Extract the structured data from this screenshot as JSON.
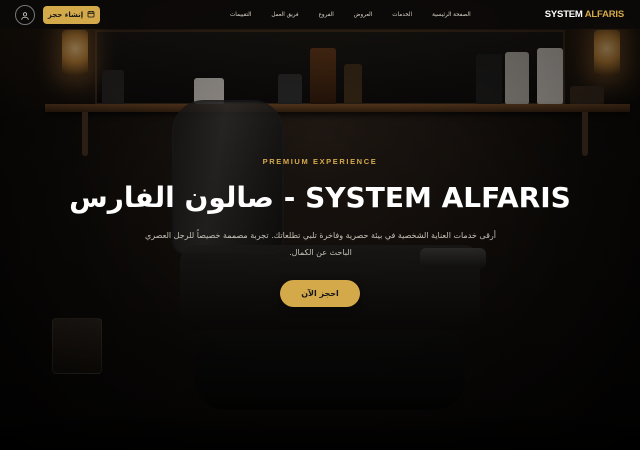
{
  "navbar": {
    "brand_primary": "SYSTEM",
    "brand_accent": "ALFARIS",
    "links": [
      {
        "label": "الصفحة الرئيسية"
      },
      {
        "label": "الخدمات"
      },
      {
        "label": "العروض"
      },
      {
        "label": "الفروع"
      },
      {
        "label": "فريق العمل"
      },
      {
        "label": "التقييمات"
      }
    ],
    "book_button_label": "إنشاء حجز",
    "book_button_icon": "calendar-icon",
    "user_icon": "user-icon"
  },
  "hero": {
    "eyebrow": "PREMIUM EXPERIENCE",
    "title": "صالون الفارس - SYSTEM ALFARIS",
    "subtitle": "أرقى خدمات العناية الشخصية في بيئة حصرية وفاخرة تلبي تطلعاتك. تجربة مصممة خصيصاً للرجل العصري الباحث عن الكمال.",
    "cta_label": "احجز الآن"
  },
  "colors": {
    "accent": "#d4a94a",
    "navbar_bg": "#0c0a09",
    "text_primary": "#ffffff",
    "text_secondary": "#c6c0b6"
  }
}
